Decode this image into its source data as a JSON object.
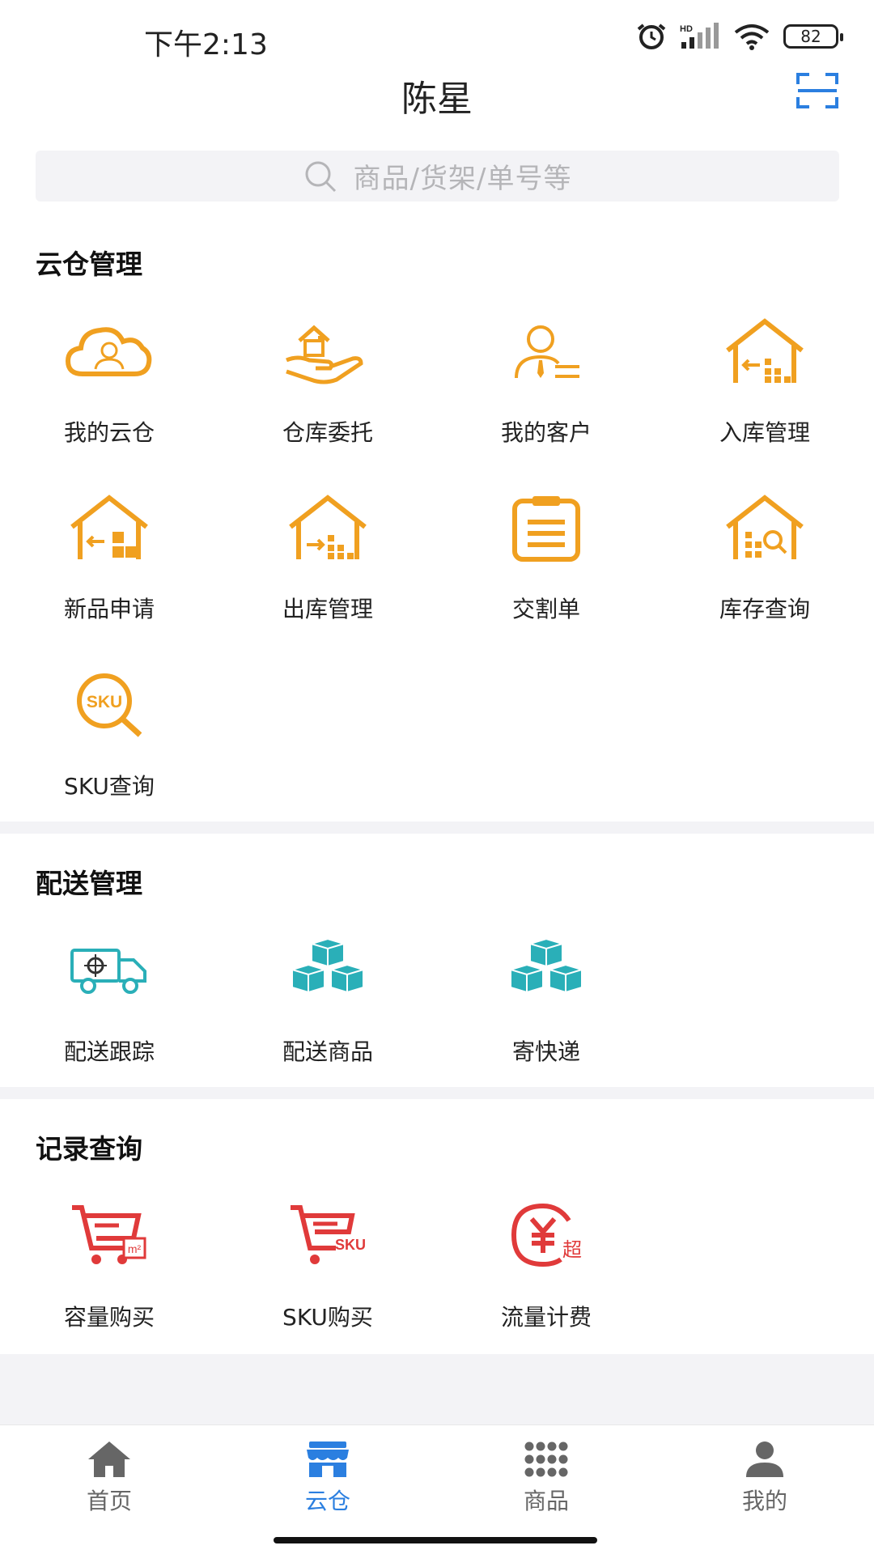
{
  "status_bar": {
    "time": "下午2:13",
    "battery": "82"
  },
  "header": {
    "title": "陈星"
  },
  "search": {
    "placeholder": "商品/货架/单号等"
  },
  "sections": {
    "cloud": {
      "title": "云仓管理",
      "items": [
        {
          "label": "我的云仓",
          "icon": "cloud-user-icon"
        },
        {
          "label": "仓库委托",
          "icon": "hand-house-icon"
        },
        {
          "label": "我的客户",
          "icon": "customer-icon"
        },
        {
          "label": "入库管理",
          "icon": "warehouse-inbound-icon"
        },
        {
          "label": "新品申请",
          "icon": "new-product-icon"
        },
        {
          "label": "出库管理",
          "icon": "warehouse-outbound-icon"
        },
        {
          "label": "交割单",
          "icon": "clipboard-icon"
        },
        {
          "label": "库存查询",
          "icon": "inventory-search-icon"
        },
        {
          "label": "SKU查询",
          "icon": "sku-search-icon"
        }
      ]
    },
    "delivery": {
      "title": "配送管理",
      "items": [
        {
          "label": "配送跟踪",
          "icon": "truck-tracking-icon"
        },
        {
          "label": "配送商品",
          "icon": "boxes-icon"
        },
        {
          "label": "寄快递",
          "icon": "boxes-icon"
        }
      ]
    },
    "records": {
      "title": "记录查询",
      "items": [
        {
          "label": "容量购买",
          "icon": "cart-capacity-icon",
          "badge": "m²"
        },
        {
          "label": "SKU购买",
          "icon": "cart-sku-icon",
          "badge": "SKU"
        },
        {
          "label": "流量计费",
          "icon": "yuan-billing-icon",
          "badge": "超"
        }
      ]
    }
  },
  "tabs": [
    {
      "label": "首页",
      "icon": "home-icon"
    },
    {
      "label": "云仓",
      "icon": "store-icon"
    },
    {
      "label": "商品",
      "icon": "grid-dots-icon"
    },
    {
      "label": "我的",
      "icon": "person-icon"
    }
  ],
  "colors": {
    "orange": "#F0A020",
    "teal": "#2AAFB8",
    "red": "#E03A3A",
    "active_tab": "#2B7FE0",
    "inactive_tab": "#666666"
  }
}
